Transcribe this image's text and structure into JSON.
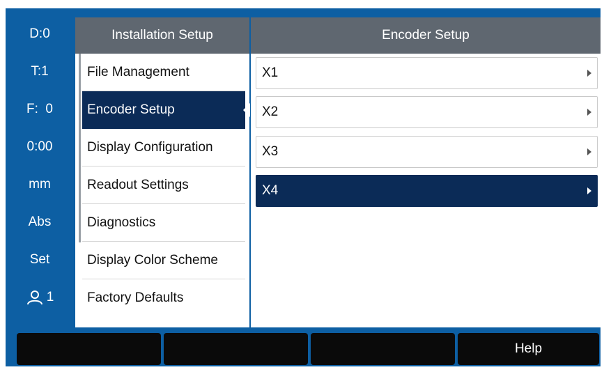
{
  "status": {
    "datum": "D:0",
    "tool": "T:1",
    "feed": "F:  0",
    "time": "0:00",
    "unit": "mm",
    "mode": "Abs",
    "set": "Set",
    "user_icon": "user-icon",
    "user_number": "1"
  },
  "menu": {
    "title": "Installation Setup",
    "items": [
      {
        "label": "File Management"
      },
      {
        "label": "Encoder Setup"
      },
      {
        "label": "Display Configuration"
      },
      {
        "label": "Readout Settings"
      },
      {
        "label": "Diagnostics"
      },
      {
        "label": "Display Color Scheme"
      },
      {
        "label": "Factory Defaults"
      }
    ],
    "active_index": 1
  },
  "detail": {
    "title": "Encoder Setup",
    "items": [
      {
        "label": "X1",
        "icon": "chevron-right-icon"
      },
      {
        "label": "X2",
        "icon": "chevron-right-icon"
      },
      {
        "label": "X3",
        "icon": "chevron-right-icon"
      },
      {
        "label": "X4",
        "icon": "chevron-right-icon"
      }
    ],
    "selected_index": 3
  },
  "softkeys": [
    "",
    "",
    "",
    "Help"
  ],
  "colors": {
    "frame": "#0d5fa3",
    "header": "#5f6770",
    "selection": "#0b2b57",
    "softkey": "#0a0a0a"
  }
}
